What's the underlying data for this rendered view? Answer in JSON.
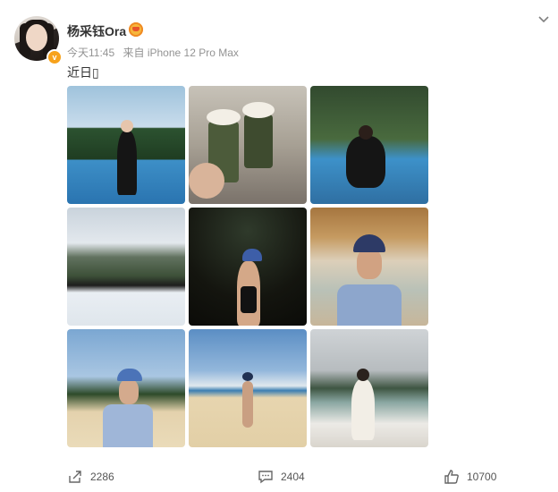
{
  "post": {
    "username": "杨采钰Ora",
    "timestamp": "今天11:45",
    "source": "来自 iPhone 12 Pro Max",
    "text": "近日▯"
  },
  "icons": {
    "verified": "verified-badge",
    "member": "member-crown-badge",
    "menu": "chevron-down-icon",
    "share": "share-icon",
    "comment": "comment-icon",
    "like": "like-icon"
  },
  "actions": {
    "share_count": "2286",
    "comment_count": "2404",
    "like_count": "10700"
  },
  "colors": {
    "accent_orange": "#f7a21b",
    "meta_gray": "#939393"
  }
}
